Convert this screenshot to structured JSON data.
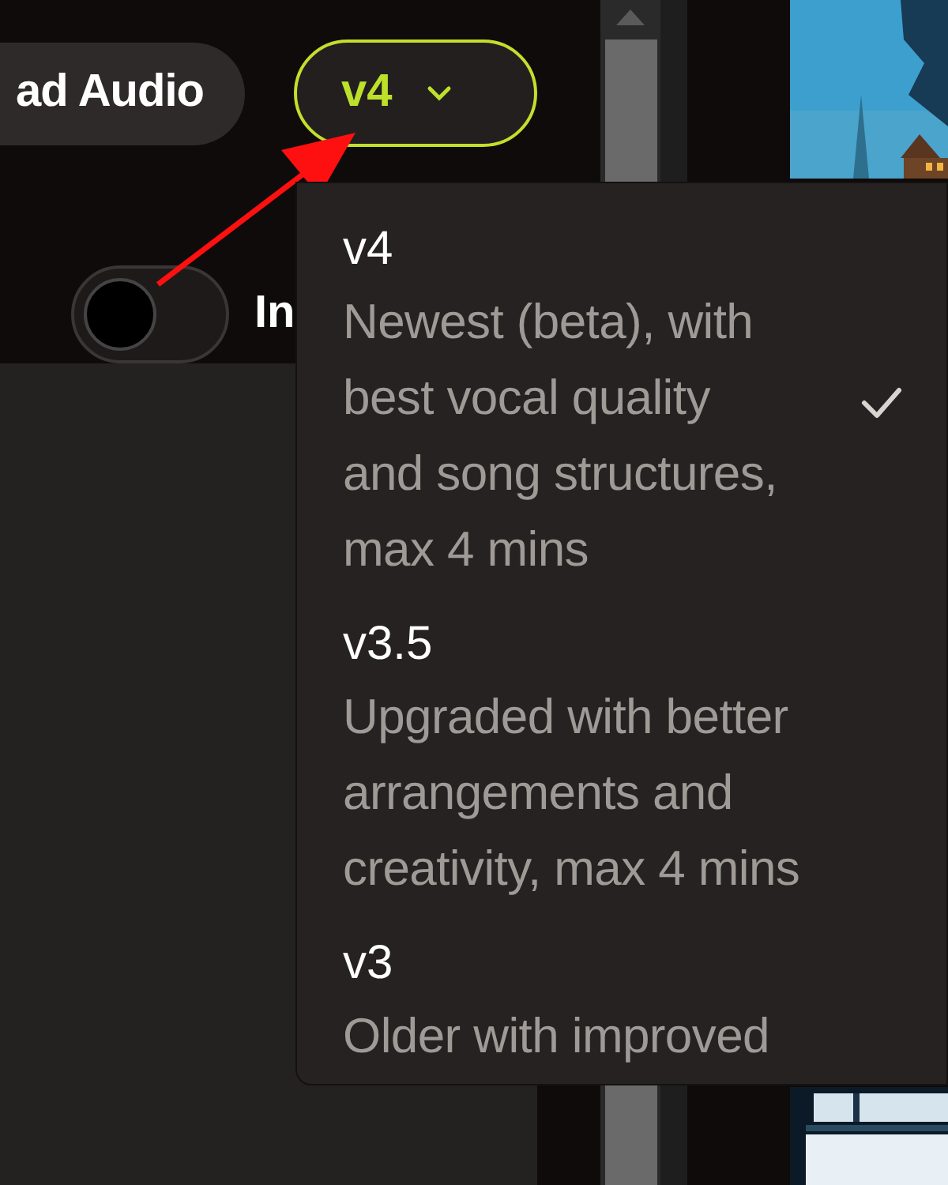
{
  "upload_button": {
    "label": "ad Audio"
  },
  "model_select": {
    "value": "v4"
  },
  "toggle": {
    "on": false,
    "label": "In"
  },
  "model_menu": {
    "items": [
      {
        "title": "v4",
        "description": "Newest (beta), with\nbest vocal quality\nand song structures,\nmax 4 mins",
        "selected": true
      },
      {
        "title": "v3.5",
        "description": "Upgraded with better\narrangements and\ncreativity, max 4 mins",
        "selected": false
      },
      {
        "title": "v3",
        "description": "Older with improved",
        "selected": false
      }
    ]
  }
}
